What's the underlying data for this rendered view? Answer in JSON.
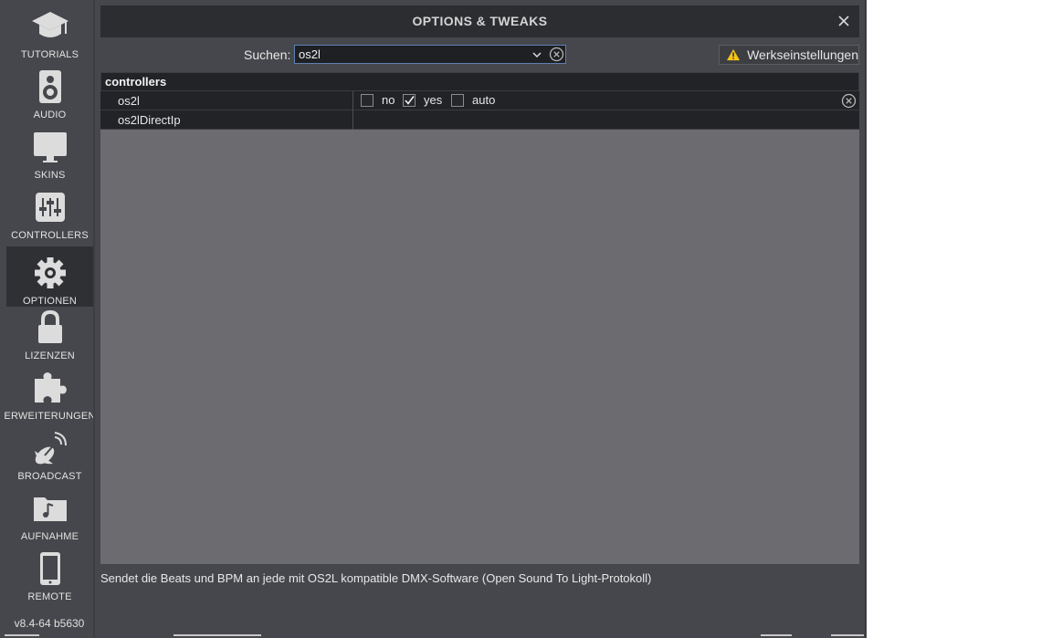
{
  "window": {
    "title": "OPTIONS & TWEAKS"
  },
  "sidebar": {
    "items": [
      {
        "label": "TUTORIALS",
        "icon": "graduation-cap-icon"
      },
      {
        "label": "AUDIO",
        "icon": "speaker-icon"
      },
      {
        "label": "SKINS",
        "icon": "monitor-icon"
      },
      {
        "label": "CONTROLLERS",
        "icon": "sliders-icon"
      },
      {
        "label": "OPTIONEN",
        "icon": "gear-icon",
        "active": true
      },
      {
        "label": "LIZENZEN",
        "icon": "lock-icon"
      },
      {
        "label": "ERWEITERUNGEN",
        "icon": "puzzle-icon"
      },
      {
        "label": "BROADCAST",
        "icon": "satellite-dish-icon"
      },
      {
        "label": "AUFNAHME",
        "icon": "music-folder-icon"
      },
      {
        "label": "REMOTE",
        "icon": "smartphone-icon"
      }
    ],
    "version": "v8.4-64 b5630"
  },
  "search": {
    "label": "Suchen:",
    "value": "os2l"
  },
  "reset": {
    "label": "Werkseinstellungen"
  },
  "options": {
    "group": "controllers",
    "rows": [
      {
        "name": "os2l",
        "choices": [
          {
            "label": "no",
            "checked": false
          },
          {
            "label": "yes",
            "checked": true
          },
          {
            "label": "auto",
            "checked": false
          }
        ]
      },
      {
        "name": "os2lDirectIp"
      }
    ]
  },
  "description": "Sendet die Beats und BPM an jede mit OS2L kompatible DMX-Software (Open Sound To Light-Protokoll)",
  "colors": {
    "background": "#46474c",
    "titlebar": "#2c2d31",
    "table_empty": "#6b6b70",
    "accent_border": "#5d7fb2",
    "warning": "#f5c518"
  }
}
